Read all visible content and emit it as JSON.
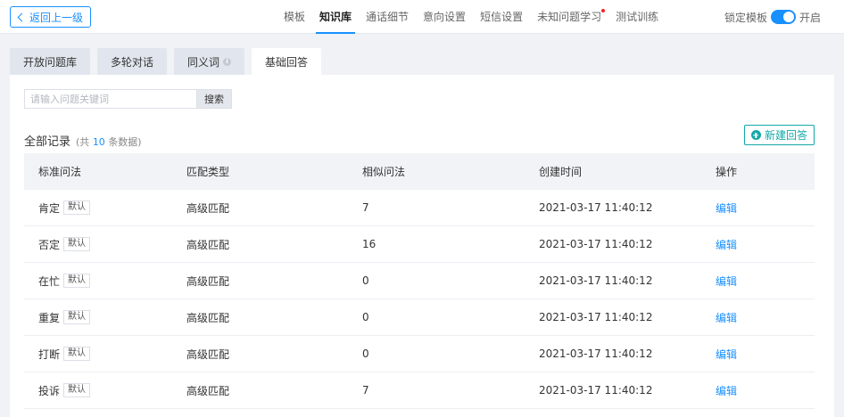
{
  "topbar": {
    "back_label": "返回上一级",
    "nav": [
      {
        "label": "模板",
        "active": false,
        "dot": false
      },
      {
        "label": "知识库",
        "active": true,
        "dot": false
      },
      {
        "label": "通话细节",
        "active": false,
        "dot": false
      },
      {
        "label": "意向设置",
        "active": false,
        "dot": false
      },
      {
        "label": "短信设置",
        "active": false,
        "dot": false
      },
      {
        "label": "未知问题学习",
        "active": false,
        "dot": true
      },
      {
        "label": "测试训练",
        "active": false,
        "dot": false
      }
    ],
    "lock_label": "锁定模板",
    "toggle_label": "开启"
  },
  "tabs": [
    {
      "label": "开放问题库",
      "active": false,
      "info": false
    },
    {
      "label": "多轮对话",
      "active": false,
      "info": false
    },
    {
      "label": "同义词",
      "active": false,
      "info": true
    },
    {
      "label": "基础回答",
      "active": true,
      "info": false
    }
  ],
  "search": {
    "placeholder": "请输入问题关键词",
    "button": "搜索"
  },
  "summary": {
    "title": "全部记录",
    "prefix": "(共",
    "count": "10",
    "suffix": "条数据)"
  },
  "new_button": "新建回答",
  "table": {
    "headers": [
      "标准问法",
      "匹配类型",
      "相似问法",
      "创建时间",
      "操作"
    ],
    "rows": [
      {
        "name": "肯定",
        "tag": "默认",
        "type": "高级匹配",
        "similar": "7",
        "time": "2021-03-17 11:40:12",
        "action": "编辑"
      },
      {
        "name": "否定",
        "tag": "默认",
        "type": "高级匹配",
        "similar": "16",
        "time": "2021-03-17 11:40:12",
        "action": "编辑"
      },
      {
        "name": "在忙",
        "tag": "默认",
        "type": "高级匹配",
        "similar": "0",
        "time": "2021-03-17 11:40:12",
        "action": "编辑"
      },
      {
        "name": "重复",
        "tag": "默认",
        "type": "高级匹配",
        "similar": "0",
        "time": "2021-03-17 11:40:12",
        "action": "编辑"
      },
      {
        "name": "打断",
        "tag": "默认",
        "type": "高级匹配",
        "similar": "0",
        "time": "2021-03-17 11:40:12",
        "action": "编辑"
      },
      {
        "name": "投诉",
        "tag": "默认",
        "type": "高级匹配",
        "similar": "7",
        "time": "2021-03-17 11:40:12",
        "action": "编辑"
      }
    ]
  },
  "colors": {
    "accent": "#1890ff",
    "teal": "#13a8a8",
    "dot": "#f5222d"
  }
}
